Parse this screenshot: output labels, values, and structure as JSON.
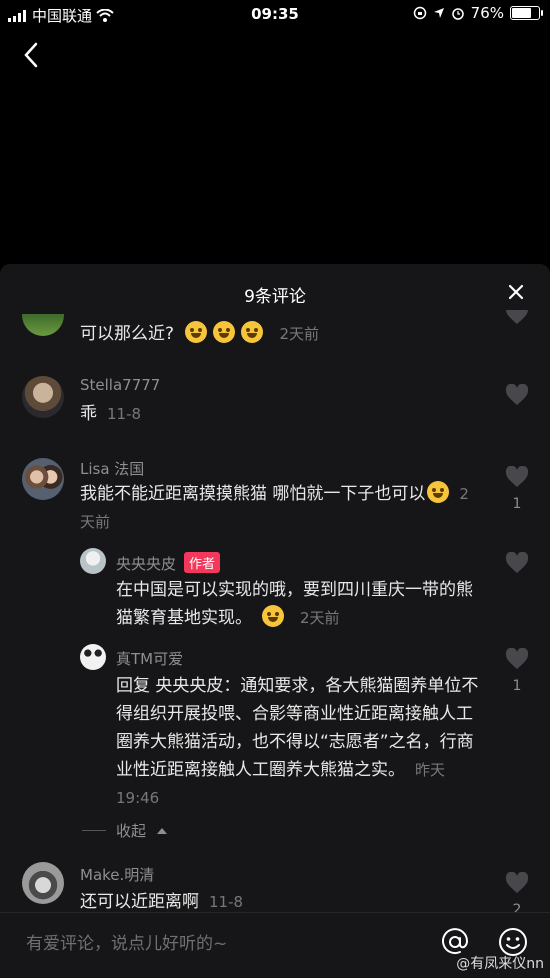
{
  "status_bar": {
    "carrier": "中国联通",
    "time": "09:35",
    "battery": "76%",
    "battery_level": 0.76
  },
  "panel": {
    "title": "9条评论"
  },
  "comments": [
    {
      "text": "可以那么近?",
      "time": "2天前"
    },
    {
      "user": "Stella7777",
      "text": "乖",
      "time": "11-8"
    },
    {
      "user": "Lisa  法国",
      "text": "我能不能近距离摸摸熊猫 哪怕就一下子也可以",
      "time": "2天前",
      "likes": "1"
    },
    {
      "user": "央央央皮",
      "tag": "作者",
      "text": "在中国是可以实现的哦，要到四川重庆一带的熊猫繁育基地实现。",
      "time": "2天前"
    },
    {
      "user": "真TM可爱",
      "text": "回复 央央央皮：通知要求，各大熊猫圈养单位不得组织开展投喂、合影等商业性近距离接触人工圈养大熊猫活动，也不得以“志愿者”之名，行商业性近距离接触人工圈养大熊猫之实。",
      "time": "昨天19:46",
      "likes": "1"
    },
    {
      "user": "Make.明清",
      "text": "还可以近距离啊",
      "time": "11-8",
      "likes": "2"
    }
  ],
  "collapse_label": "收起",
  "input": {
    "placeholder": "有爱评论，说点儿好听的~"
  },
  "watermark": "@有凤来仪nn",
  "colors": {
    "panel_bg": "#161618",
    "author_tag": "#f2385b",
    "muted": "#8e8e93"
  }
}
